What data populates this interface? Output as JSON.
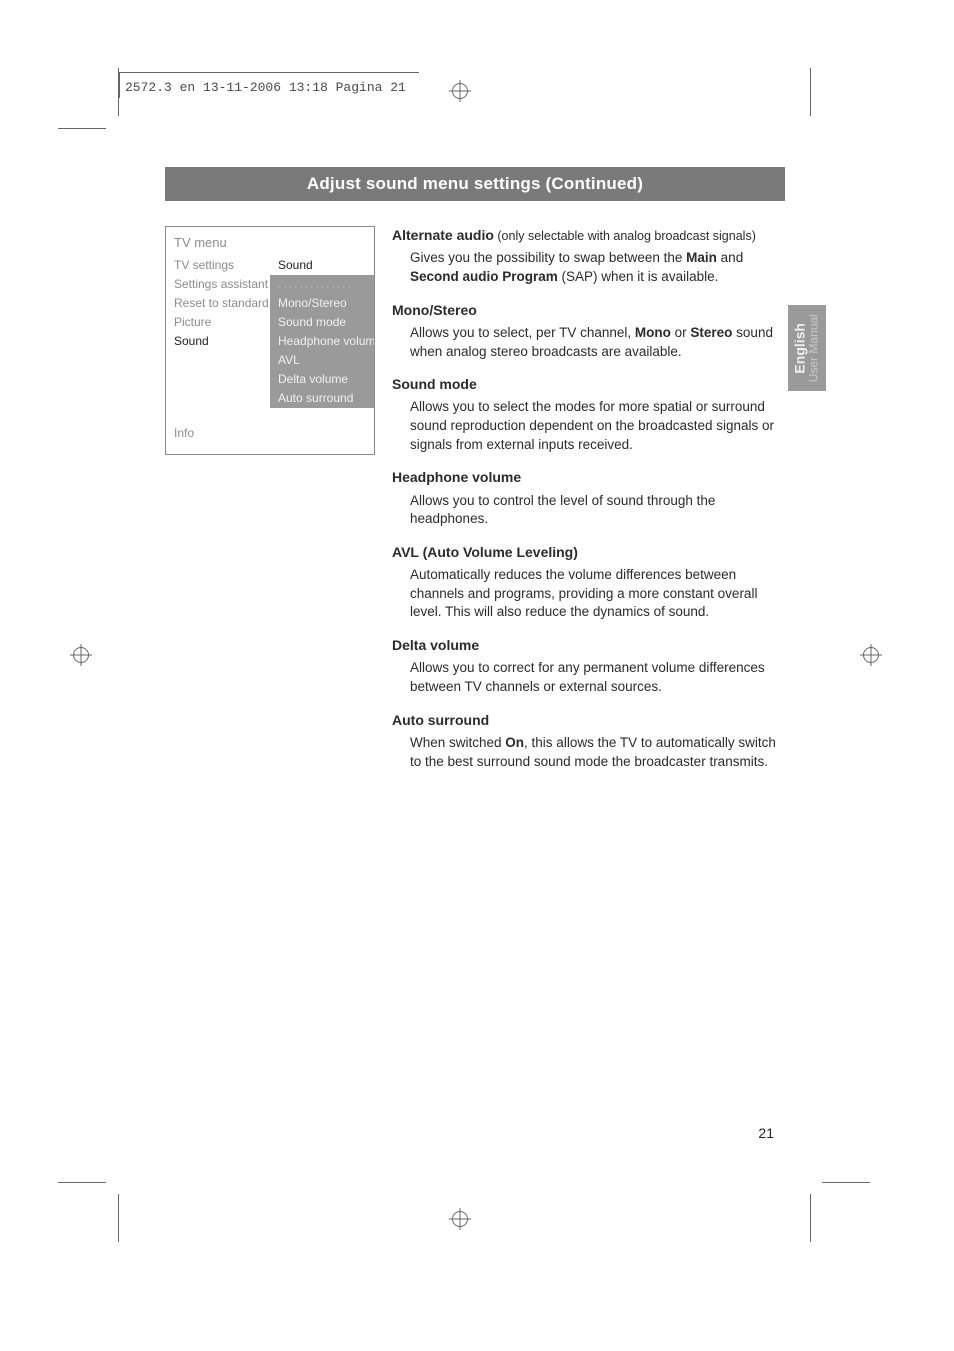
{
  "print": {
    "header": "2572.3 en  13-11-2006  13:18  Pagina 21"
  },
  "titlebar": "Adjust sound menu settings   (Continued)",
  "menu": {
    "title": "TV menu",
    "left": [
      {
        "label": "TV settings",
        "sel": false
      },
      {
        "label": "Settings assistant",
        "sel": false
      },
      {
        "label": "Reset to standard",
        "sel": false
      },
      {
        "label": "Picture",
        "sel": false
      },
      {
        "label": "Sound",
        "sel": true
      },
      {
        "label": "",
        "sel": false
      },
      {
        "label": "",
        "sel": false
      },
      {
        "label": "",
        "sel": false
      }
    ],
    "right": [
      {
        "label": "Sound",
        "cls": "sel-right"
      },
      {
        "label": "..............",
        "cls": "dim dots"
      },
      {
        "label": "Mono/Stereo",
        "cls": "dim"
      },
      {
        "label": "Sound mode",
        "cls": "dim"
      },
      {
        "label": "Headphone volume",
        "cls": "dim"
      },
      {
        "label": "AVL",
        "cls": "dim"
      },
      {
        "label": "Delta volume",
        "cls": "dim"
      },
      {
        "label": "Auto surround",
        "cls": "dim"
      }
    ],
    "info": "Info"
  },
  "sections": {
    "alt_audio": {
      "h": "Alternate audio",
      "hnote": " (only selectable with analog broadcast signals)",
      "p1a": "Gives you the possibility to swap between the ",
      "p1b": "Main",
      "p1c": " and ",
      "p1d": "Second audio Program",
      "p1e": " (SAP) when it is available."
    },
    "mono": {
      "h": "Mono/Stereo",
      "p1a": "Allows you to select, per TV channel, ",
      "p1b": "Mono",
      "p1c": " or ",
      "p1d": "Stereo",
      "p1e": " sound when analog stereo broadcasts are available."
    },
    "sound_mode": {
      "h": "Sound mode",
      "p": "Allows you to select the modes for more spatial or surround sound reproduction dependent on the broadcasted signals or signals from external inputs received."
    },
    "headphone": {
      "h": "Headphone volume",
      "p": "Allows you to control the level of sound through the headphones."
    },
    "avl": {
      "h": "AVL (Auto  Volume Leveling)",
      "p": "Automatically reduces the volume differences between channels and programs, providing a more constant overall level. This will also reduce the dynamics of sound."
    },
    "delta": {
      "h": "Delta volume",
      "p": "Allows you to correct for any permanent volume differences between TV channels or external sources."
    },
    "auto_surround": {
      "h": "Auto surround",
      "p1a": "When switched ",
      "p1b": "On",
      "p1c": ", this allows the TV to automatically switch to the best surround sound mode the broadcaster transmits."
    }
  },
  "sidetab": {
    "lang": "English",
    "sub": "User Manual"
  },
  "pagenum": "21"
}
